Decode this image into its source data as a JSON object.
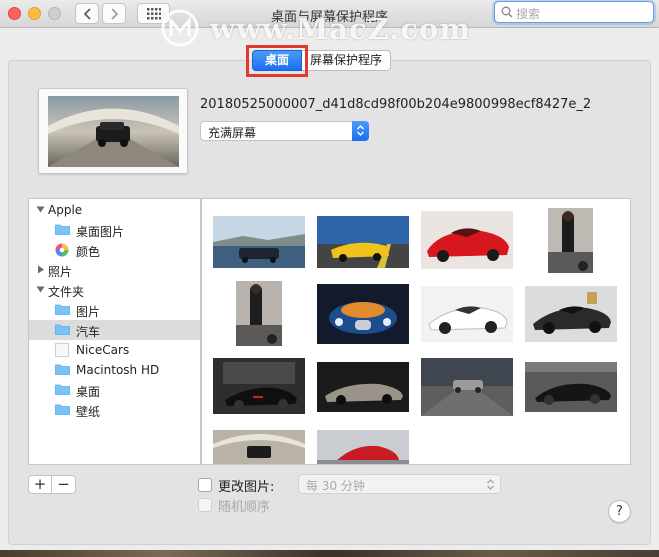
{
  "window": {
    "title": "桌面与屏幕保护程序"
  },
  "search": {
    "placeholder": "搜索"
  },
  "watermark": {
    "text": "www.MacZ.com"
  },
  "tabs": [
    {
      "label": "桌面",
      "active": true
    },
    {
      "label": "屏幕保护程序",
      "active": false
    }
  ],
  "current": {
    "filename": "20180525000007_d41d8cd98f00b204e9800998ecf8427e_2",
    "fit_option": "充满屏幕"
  },
  "sidebar": {
    "items": [
      {
        "label": "Apple",
        "level": 1,
        "disclosure": "expanded",
        "icon": "none"
      },
      {
        "label": "桌面图片",
        "level": 2,
        "icon": "folder-icon"
      },
      {
        "label": "颜色",
        "level": 2,
        "icon": "color-wheel-icon"
      },
      {
        "label": "照片",
        "level": 1,
        "disclosure": "collapsed",
        "icon": "none"
      },
      {
        "label": "文件夹",
        "level": 1,
        "disclosure": "expanded",
        "icon": "none"
      },
      {
        "label": "图片",
        "level": 2,
        "icon": "folder-icon"
      },
      {
        "label": "汽车",
        "level": 2,
        "icon": "folder-icon",
        "selected": true
      },
      {
        "label": "NiceCars",
        "level": 2,
        "icon": "blank-folder-icon"
      },
      {
        "label": "Macintosh HD",
        "level": 2,
        "icon": "folder-icon"
      },
      {
        "label": "桌面",
        "level": 2,
        "icon": "folder-icon"
      },
      {
        "label": "壁纸",
        "level": 2,
        "icon": "folder-icon"
      }
    ]
  },
  "gallery": {
    "thumbnails": [
      "car-photo-sedan-coast",
      "car-photo-yellow-sports",
      "car-photo-red-ferrari",
      "car-photo-model-portrait",
      "car-photo-model-portrait",
      "car-photo-bugatti-front",
      "car-photo-white-lamborghini",
      "car-photo-black-lamborghini",
      "car-photo-black-mclaren",
      "car-photo-silver-coupe",
      "car-photo-road-silver",
      "car-photo-black-supercar-studio",
      "car-photo-suv-road",
      "car-photo-red-supercar"
    ]
  },
  "controls": {
    "add": "+",
    "remove": "−",
    "change_picture_label": "更改图片:",
    "interval": "每 30 分钟",
    "random_order_label": "随机顺序",
    "help": "?"
  },
  "colors": {
    "accent": "#1a6ff2",
    "highlight_box": "#e03a2e",
    "selected_row": "#dcdcdc"
  }
}
